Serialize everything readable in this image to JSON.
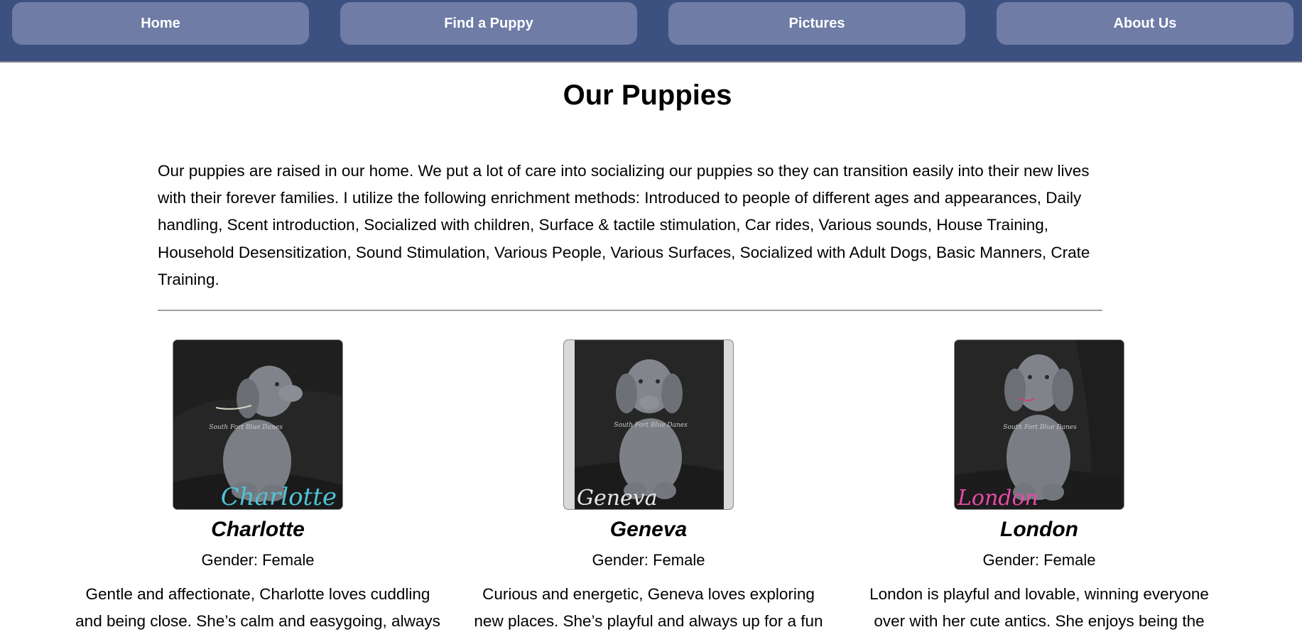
{
  "nav": {
    "home": "Home",
    "find": "Find a Puppy",
    "pictures": "Pictures",
    "about": "About Us"
  },
  "page": {
    "title": "Our Puppies",
    "intro": "Our puppies are raised in our home. We put a lot of care into socializing our puppies so they can transition easily into their new lives with their forever families. I utilize the following enrichment methods: Introduced to people of different ages and appearances, Daily handling, Scent introduction, Socialized with children, Surface & tactile stimulation, Car rides, Various sounds, House Training, Household Desensitization, Sound Stimulation, Various People, Various Surfaces, Socialized with Adult Dogs, Basic Manners, Crate Training."
  },
  "puppies": [
    {
      "name": "Charlotte",
      "gender": "Gender: Female",
      "description": "Gentle and affectionate, Charlotte loves cuddling and being close. She’s calm and easygoing, always",
      "photo_caption": "Charlotte",
      "watermark": "South Fort Blue Danes",
      "caption_color": "#4fc3d4"
    },
    {
      "name": "Geneva",
      "gender": "Gender: Female",
      "description": "Curious and energetic, Geneva loves exploring new places. She’s playful and always up for a fun outing",
      "photo_caption": "Geneva",
      "watermark": "South Fort Blue Danes",
      "caption_color": "#e8e8e8"
    },
    {
      "name": "London",
      "gender": "Gender: Female",
      "description": "London is playful and lovable, winning everyone over with her cute antics. She enjoys being the",
      "photo_caption": "London",
      "watermark": "South Fort Blue Danes",
      "caption_color": "#e84aa8"
    }
  ],
  "colors": {
    "nav_bar": "#3d5181",
    "nav_button": "#6e7ca6"
  }
}
